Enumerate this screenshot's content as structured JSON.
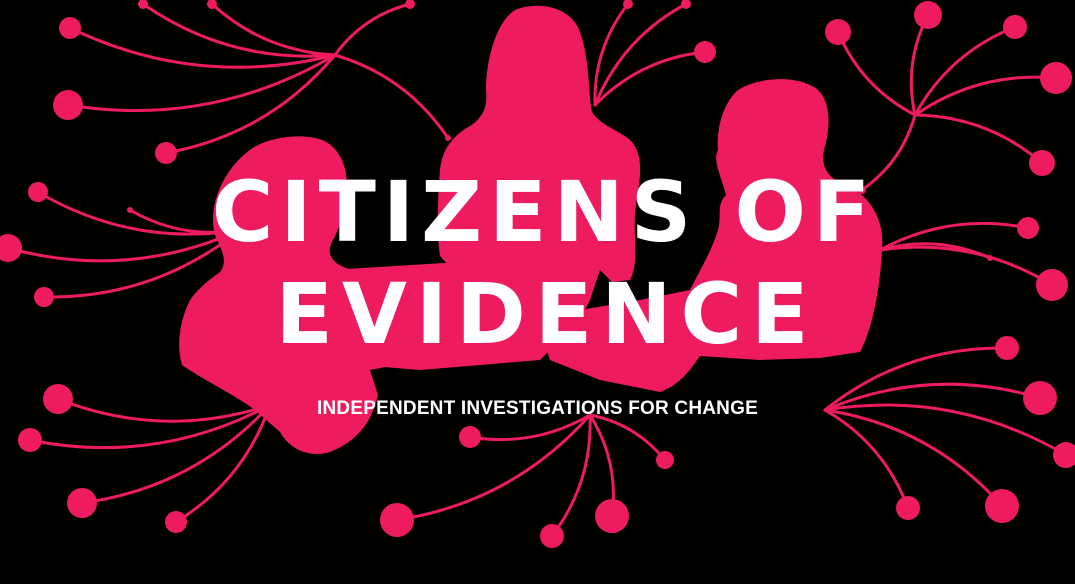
{
  "banner": {
    "title_line_1": "CITIZENS OF",
    "title_line_2": "EVIDENCE",
    "tagline": "INDEPENDENT INVESTIGATIONS FOR CHANGE"
  },
  "colors": {
    "background": "#000000",
    "accent": "#ee1c5e",
    "text": "#ffffff"
  },
  "illustration": {
    "figures": [
      "person-left",
      "person-center",
      "person-right"
    ],
    "motif": "network-burst"
  }
}
